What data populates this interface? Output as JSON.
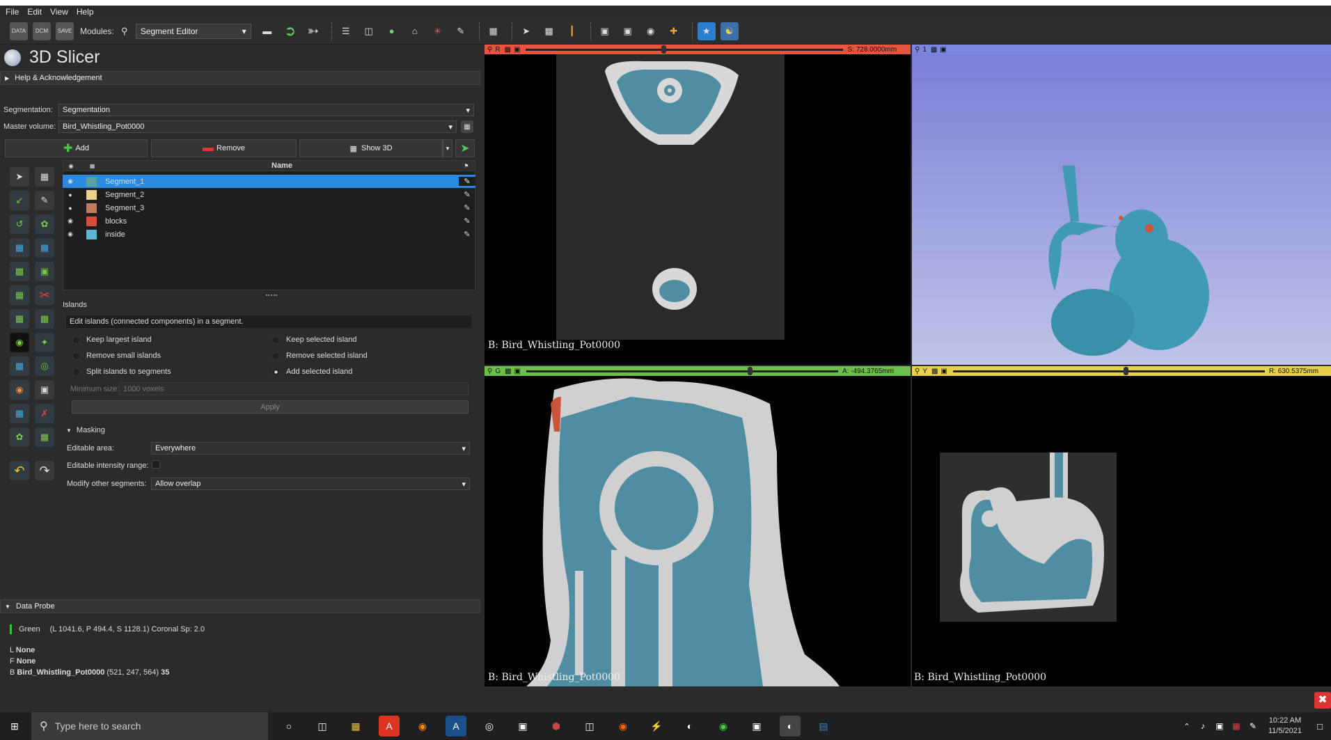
{
  "menu": [
    "File",
    "Edit",
    "View",
    "Help"
  ],
  "toolbar": {
    "modules_label": "Modules:",
    "module_selected": "Segment Editor"
  },
  "app_title": "3D Slicer",
  "help_section": "Help & Acknowledgement",
  "segmentation": {
    "label": "Segmentation:",
    "value": "Segmentation"
  },
  "master_volume": {
    "label": "Master volume:",
    "value": "Bird_Whistling_Pot0000"
  },
  "buttons": {
    "add": "Add",
    "remove": "Remove",
    "show3d": "Show 3D"
  },
  "table": {
    "header_name": "Name",
    "segments": [
      {
        "name": "Segment_1",
        "color": "#5aa0a0",
        "selected": true
      },
      {
        "name": "Segment_2",
        "color": "#f0d08a",
        "selected": false
      },
      {
        "name": "Segment_3",
        "color": "#c27a5c",
        "selected": false
      },
      {
        "name": "blocks",
        "color": "#d2503c",
        "selected": false
      },
      {
        "name": "inside",
        "color": "#5fb4d2",
        "selected": false
      }
    ]
  },
  "islands": {
    "title": "Islands",
    "description": "Edit islands (connected components) in a segment.",
    "options": [
      "Keep largest island",
      "Keep selected island",
      "Remove small islands",
      "Remove selected island",
      "Split islands to segments",
      "Add selected island"
    ],
    "selected": "Add selected island",
    "min_size_label": "Minimum size:",
    "min_size_value": "1000 voxels",
    "apply": "Apply"
  },
  "masking": {
    "title": "Masking",
    "editable_area_label": "Editable area:",
    "editable_area_value": "Everywhere",
    "intensity_label": "Editable intensity range:",
    "modify_label": "Modify other segments:",
    "modify_value": "Allow overlap"
  },
  "data_probe": {
    "title": "Data Probe",
    "view": "Green",
    "coords": "(L 1041.6, P 494.4, S 1128.1)  Coronal Sp: 2.0",
    "l_label": "L",
    "l_value": "None",
    "f_label": "F",
    "f_value": "None",
    "b_label": "B",
    "b_volume": "Bird_Whistling_Pot0000",
    "b_ijk": "(521, 247, 564)",
    "b_value": "35"
  },
  "views": {
    "red": {
      "letter": "R",
      "offset": "S: 728.0000mm",
      "label": "B: Bird_Whistling_Pot0000",
      "color": "#e8553e"
    },
    "threeD": {
      "letter": "1",
      "color": "#7a86e0"
    },
    "green": {
      "letter": "G",
      "offset": "A: -494.3765mm",
      "label": "B: Bird_Whistling_Pot0000",
      "color": "#6cc04a"
    },
    "yellow": {
      "letter": "Y",
      "offset": "R: 630.5375mm",
      "label": "B: Bird_Whistling_Pot0000",
      "color": "#e7d04a"
    }
  },
  "taskbar": {
    "search_placeholder": "Type here to search",
    "time": "10:22 AM",
    "date": "11/5/2021"
  }
}
